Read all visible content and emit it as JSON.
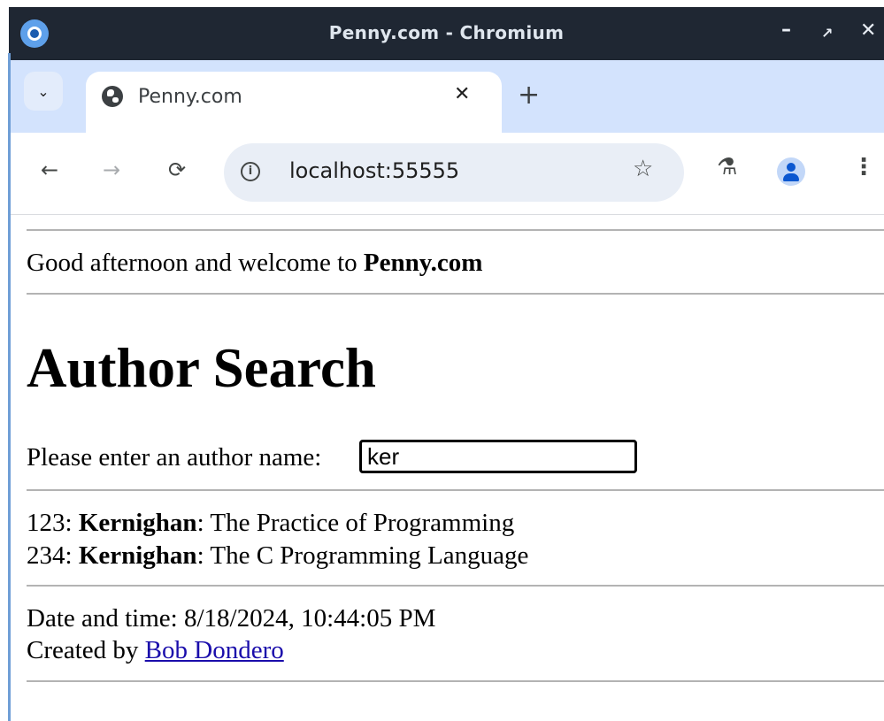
{
  "window": {
    "title": "Penny.com - Chromium",
    "minimize_glyph": "–",
    "maximize_glyph": "↗",
    "close_glyph": "✕"
  },
  "tab": {
    "title": "Penny.com",
    "close_glyph": "✕",
    "new_tab_glyph": "+",
    "dropdown_glyph": "⌄"
  },
  "toolbar": {
    "back_glyph": "←",
    "forward_glyph": "→",
    "reload_glyph": "⟳",
    "info_glyph": "i",
    "url": "localhost:55555",
    "star_glyph": "☆",
    "labs_glyph": "⚗",
    "menu_glyph": "⋮"
  },
  "page": {
    "greeting_prefix": "Good afternoon and welcome to ",
    "greeting_site": "Penny.com",
    "heading": "Author Search",
    "prompt_label": "Please enter an author name:",
    "search_value": "ker",
    "results": [
      {
        "id": "123",
        "author": "Kernighan",
        "title": "The Practice of Programming"
      },
      {
        "id": "234",
        "author": "Kernighan",
        "title": "The C Programming Language"
      }
    ],
    "datetime_label": "Date and time: 8/18/2024, 10:44:05 PM",
    "created_by_prefix": "Created by ",
    "creator_name": "Bob Dondero"
  },
  "colors": {
    "titlebar": "#1f2733",
    "tabstrip": "#d3e3fd",
    "omnibox": "#e9eef6",
    "link": "#1a0dab",
    "profile_accent": "#0b57d0"
  }
}
